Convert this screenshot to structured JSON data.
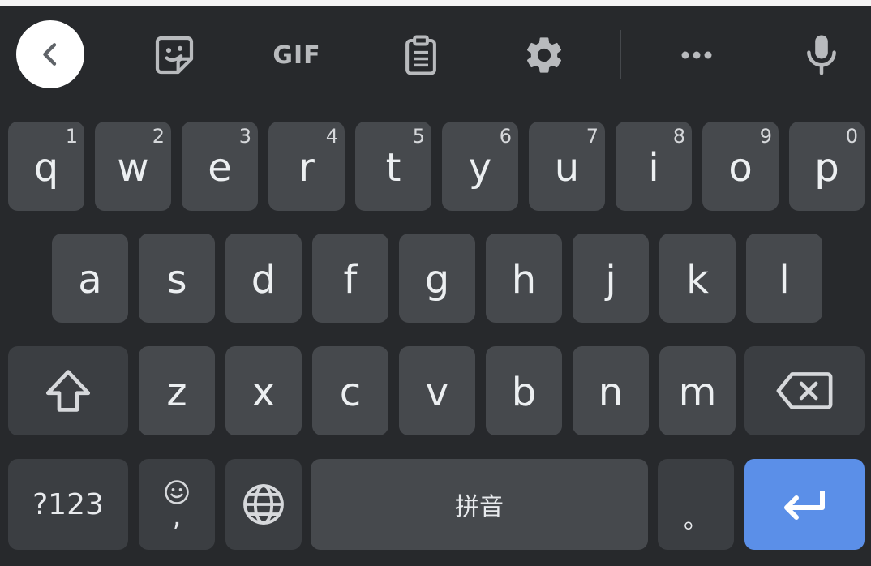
{
  "toolbar": {
    "gif_label": "GIF",
    "icons": [
      "back-chevron-icon",
      "sticker-icon",
      "clipboard-icon",
      "gear-icon",
      "more-icon",
      "microphone-icon"
    ]
  },
  "rows": {
    "row1": [
      {
        "label": "q",
        "hint": "1"
      },
      {
        "label": "w",
        "hint": "2"
      },
      {
        "label": "e",
        "hint": "3"
      },
      {
        "label": "r",
        "hint": "4"
      },
      {
        "label": "t",
        "hint": "5"
      },
      {
        "label": "y",
        "hint": "6"
      },
      {
        "label": "u",
        "hint": "7"
      },
      {
        "label": "i",
        "hint": "8"
      },
      {
        "label": "o",
        "hint": "9"
      },
      {
        "label": "p",
        "hint": "0"
      }
    ],
    "row2": [
      "a",
      "s",
      "d",
      "f",
      "g",
      "h",
      "j",
      "k",
      "l"
    ],
    "row3": [
      "z",
      "x",
      "c",
      "v",
      "b",
      "n",
      "m"
    ]
  },
  "bottom": {
    "symbols_label": "?123",
    "comma_label": ",",
    "space_label": "拼音",
    "period_label": "。"
  },
  "colors": {
    "background": "#27292c",
    "key": "#46494d",
    "function_key": "#3b3e42",
    "enter_key": "#5b8fe8",
    "text": "#eceff1"
  }
}
